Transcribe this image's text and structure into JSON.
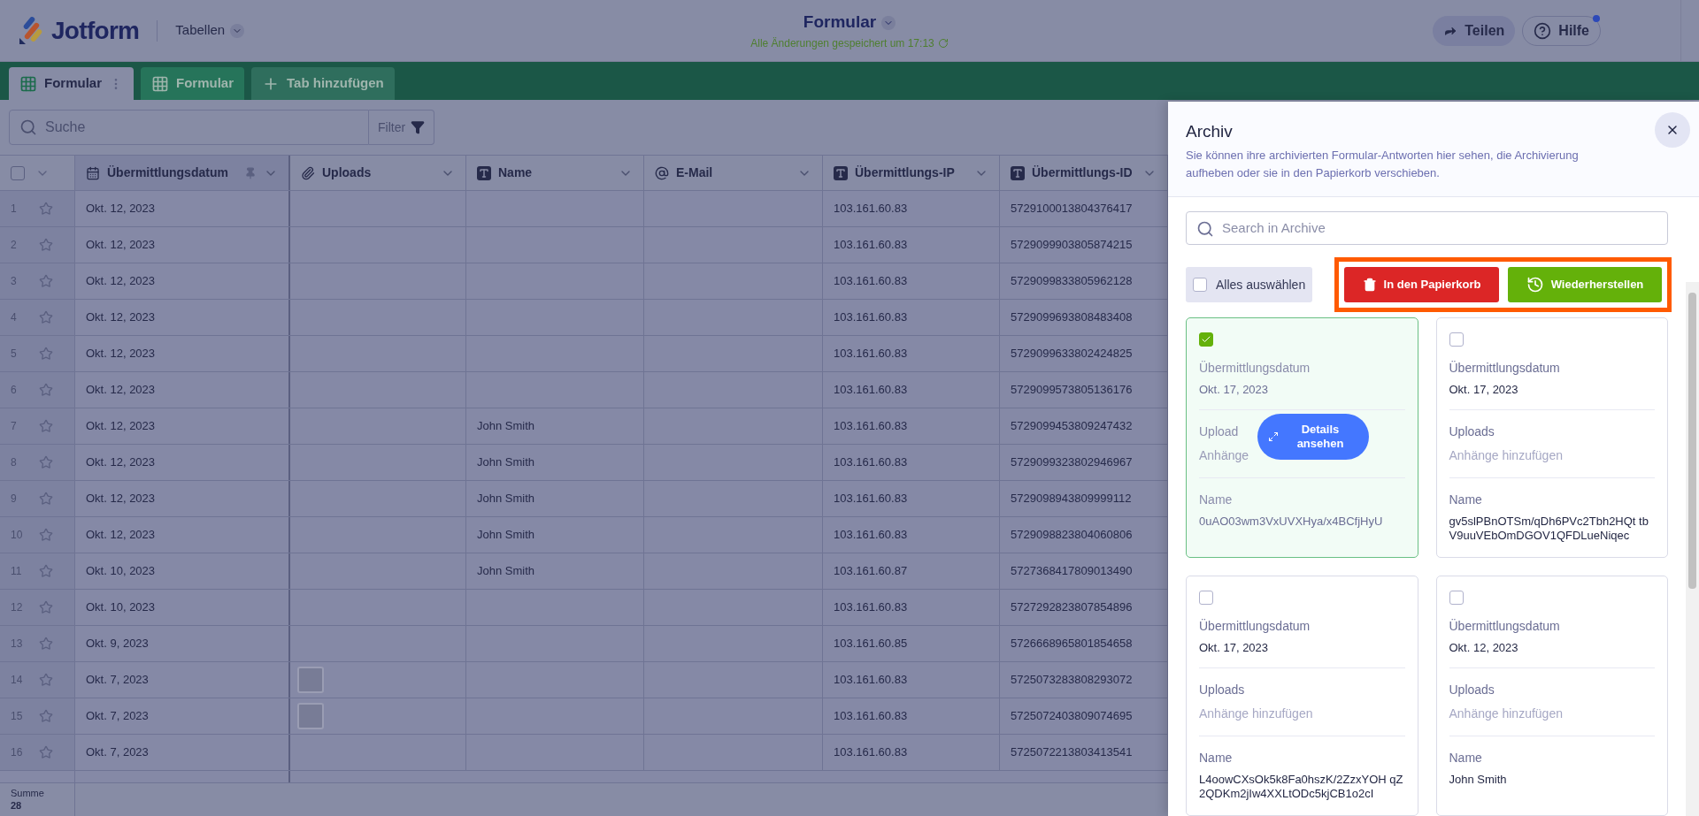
{
  "header": {
    "logo": "Jotform",
    "menu": "Tabellen",
    "title": "Formular",
    "saved": "Alle Änderungen gespeichert um 17:13",
    "share": "Teilen",
    "help": "Hilfe",
    "help_notification": true
  },
  "tabs": [
    {
      "label": "Formular",
      "selected": true
    },
    {
      "label": "Formular",
      "selected": false
    }
  ],
  "add_tab": "Tab hinzufügen",
  "toolbar": {
    "search_placeholder": "Suche",
    "filter": "Filter"
  },
  "table": {
    "select_all_checked": false,
    "columns": [
      {
        "label": "Übermittlungsdatum",
        "kind": "date",
        "pinned": true
      },
      {
        "label": "Uploads",
        "kind": "file"
      },
      {
        "label": "Name",
        "kind": "text"
      },
      {
        "label": "E-Mail",
        "kind": "email"
      },
      {
        "label": "Übermittlungs-IP",
        "kind": "text"
      },
      {
        "label": "Übermittlungs-ID",
        "kind": "text"
      }
    ],
    "rows": [
      {
        "number": "1",
        "date": "Okt. 12, 2023",
        "attachment": false,
        "name": "",
        "ip": "103.161.60.83",
        "id": "5729100013804376417"
      },
      {
        "number": "2",
        "date": "Okt. 12, 2023",
        "attachment": false,
        "name": "",
        "ip": "103.161.60.83",
        "id": "5729099903805874215"
      },
      {
        "number": "3",
        "date": "Okt. 12, 2023",
        "attachment": false,
        "name": "",
        "ip": "103.161.60.83",
        "id": "5729099833805962128"
      },
      {
        "number": "4",
        "date": "Okt. 12, 2023",
        "attachment": false,
        "name": "",
        "ip": "103.161.60.83",
        "id": "5729099693808483408"
      },
      {
        "number": "5",
        "date": "Okt. 12, 2023",
        "attachment": false,
        "name": "",
        "ip": "103.161.60.83",
        "id": "5729099633802424825"
      },
      {
        "number": "6",
        "date": "Okt. 12, 2023",
        "attachment": false,
        "name": "",
        "ip": "103.161.60.83",
        "id": "5729099573805136176"
      },
      {
        "number": "7",
        "date": "Okt. 12, 2023",
        "attachment": false,
        "name": "John Smith",
        "ip": "103.161.60.83",
        "id": "5729099453809247432"
      },
      {
        "number": "8",
        "date": "Okt. 12, 2023",
        "attachment": false,
        "name": "John Smith",
        "ip": "103.161.60.83",
        "id": "5729099323802946967"
      },
      {
        "number": "9",
        "date": "Okt. 12, 2023",
        "attachment": false,
        "name": "John Smith",
        "ip": "103.161.60.83",
        "id": "5729098943809999112"
      },
      {
        "number": "10",
        "date": "Okt. 12, 2023",
        "attachment": false,
        "name": "John Smith",
        "ip": "103.161.60.83",
        "id": "5729098823804060806"
      },
      {
        "number": "11",
        "date": "Okt. 10, 2023",
        "attachment": false,
        "name": "John Smith",
        "ip": "103.161.60.87",
        "id": "5727368417809013490"
      },
      {
        "number": "12",
        "date": "Okt. 10, 2023",
        "attachment": false,
        "name": "",
        "ip": "103.161.60.83",
        "id": "5727292823807854896"
      },
      {
        "number": "13",
        "date": "Okt. 9, 2023",
        "attachment": false,
        "name": "",
        "ip": "103.161.60.85",
        "id": "5726668965801854658"
      },
      {
        "number": "14",
        "date": "Okt. 7, 2023",
        "attachment": true,
        "name": "",
        "ip": "103.161.60.83",
        "id": "5725073283808293072"
      },
      {
        "number": "15",
        "date": "Okt. 7, 2023",
        "attachment": true,
        "name": "",
        "ip": "103.161.60.83",
        "id": "5725072403809074695"
      },
      {
        "number": "16",
        "date": "Okt. 7, 2023",
        "attachment": false,
        "name": "",
        "ip": "103.161.60.83",
        "id": "5725072213803413541"
      }
    ],
    "summary_label": "Summe",
    "summary_value": "28"
  },
  "archive": {
    "title": "Archiv",
    "description": "Sie können ihre archivierten Formular-Antworten hier sehen, die Archivierung aufheben oder sie in den Papierkorb verschieben.",
    "search_placeholder": "Search in Archive",
    "select_all": {
      "label": "Alles auswählen",
      "checked": false
    },
    "trash_button": "In den Papierkorb",
    "restore_button": "Wiederherstellen",
    "details_button": "Details ansehen",
    "cards": [
      {
        "selected": true,
        "hovered": true,
        "fields": [
          {
            "label": "Übermittlungsdatum",
            "value": "Okt. 17, 2023"
          },
          {
            "label": "Upload",
            "placeholder": "Anhänge"
          },
          {
            "label": "Name",
            "value": "0uAO03wm3VxUVXHya/x4BCfjHyU"
          }
        ]
      },
      {
        "selected": false,
        "hovered": false,
        "fields": [
          {
            "label": "Übermittlungsdatum",
            "value": "Okt. 17, 2023"
          },
          {
            "label": "Uploads",
            "placeholder": "Anhänge hinzufügen"
          },
          {
            "label": "Name",
            "value": "gv5slPBnOTSm/qDh6PVc2Tbh2HQt tbV9uuVEbOmDGOV1QFDLueNiqec"
          }
        ]
      },
      {
        "selected": false,
        "hovered": false,
        "fields": [
          {
            "label": "Übermittlungsdatum",
            "value": "Okt. 17, 2023"
          },
          {
            "label": "Uploads",
            "placeholder": "Anhänge hinzufügen"
          },
          {
            "label": "Name",
            "value": "L4oowCXsOk5k8Fa0hszK/2ZzxYOH qZ2QDKm2jIw4XXLtODc5kjCB1o2cI"
          }
        ]
      },
      {
        "selected": false,
        "hovered": false,
        "fields": [
          {
            "label": "Übermittlungsdatum",
            "value": "Okt. 12, 2023"
          },
          {
            "label": "Uploads",
            "placeholder": "Anhänge hinzufügen"
          },
          {
            "label": "Name",
            "value": "John Smith"
          }
        ]
      }
    ]
  }
}
